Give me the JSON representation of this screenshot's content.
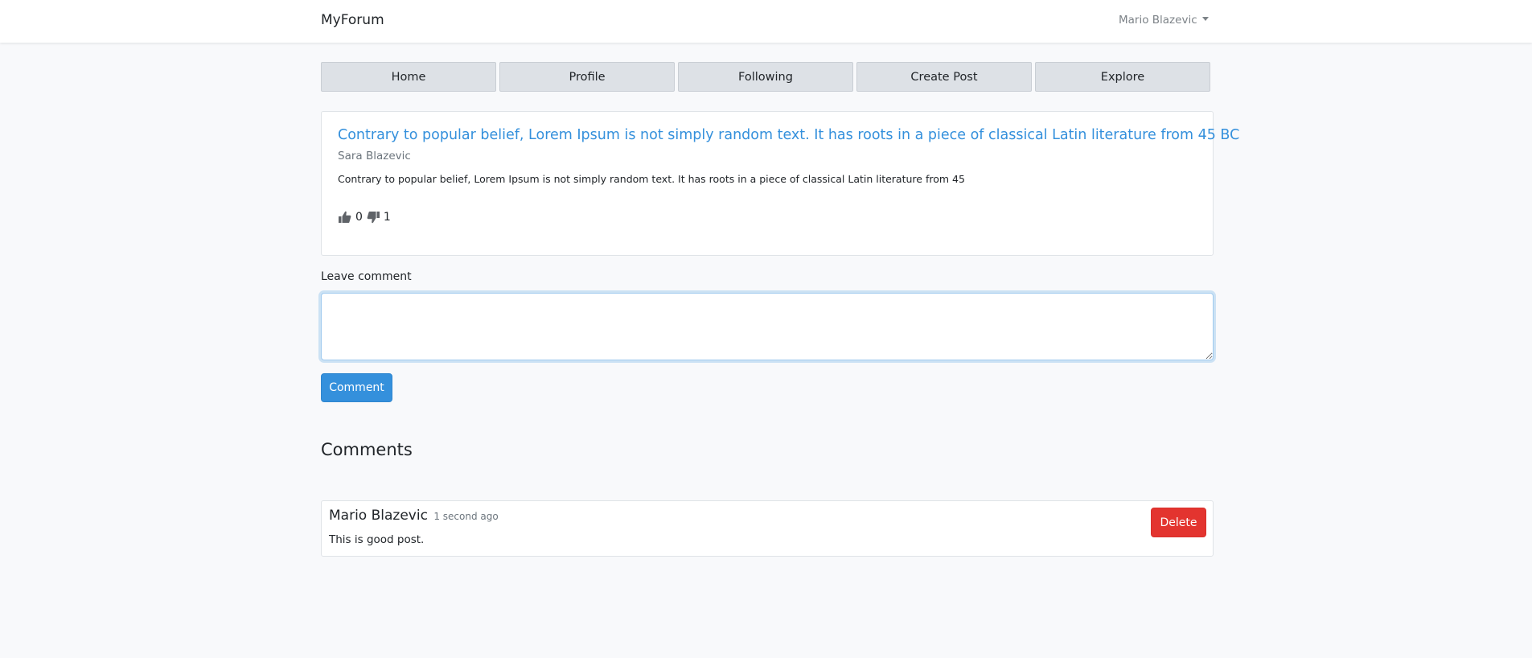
{
  "navbar": {
    "brand": "MyForum",
    "user_name": "Mario Blazevic"
  },
  "tabs": [
    {
      "label": "Home"
    },
    {
      "label": "Profile"
    },
    {
      "label": "Following"
    },
    {
      "label": "Create Post"
    },
    {
      "label": "Explore"
    }
  ],
  "post": {
    "title": "Contrary to popular belief, Lorem Ipsum is not simply random text. It has roots in a piece of classical Latin literature from 45 BC",
    "author": "Sara Blazevic",
    "body": "Contrary to popular belief, Lorem Ipsum is not simply random text. It has roots in a piece of classical Latin literature from 45",
    "likes": "0",
    "dislikes": "1",
    "like_icon": "thumbs-up-icon",
    "dislike_icon": "thumbs-down-icon"
  },
  "comment_form": {
    "label": "Leave comment",
    "value": "",
    "button_label": "Comment"
  },
  "comments_section": {
    "heading": "Comments",
    "items": [
      {
        "author": "Mario Blazevic",
        "time": "1 second ago",
        "text": "This is good post.",
        "delete_label": "Delete"
      }
    ]
  },
  "colors": {
    "primary": "#3490dc",
    "danger": "#e3342f",
    "background": "#f8f9fb",
    "tab_background": "#dde1e6"
  }
}
